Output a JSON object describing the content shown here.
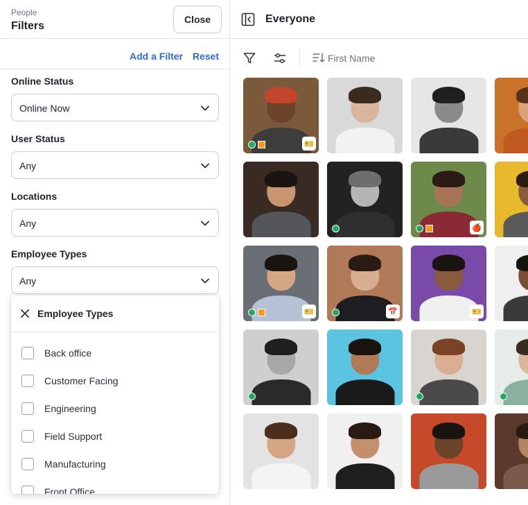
{
  "filters_panel": {
    "breadcrumb": "People",
    "title": "Filters",
    "close_label": "Close",
    "add_filter_label": "Add a Filter",
    "reset_label": "Reset",
    "accent_color": "#2e6bd1",
    "fields": [
      {
        "label": "Online Status",
        "value": "Online Now"
      },
      {
        "label": "User Status",
        "value": "Any"
      },
      {
        "label": "Locations",
        "value": "Any"
      },
      {
        "label": "Employee Types",
        "value": "Any"
      }
    ],
    "dropdown": {
      "title": "Employee Types",
      "options": [
        {
          "label": "Back office",
          "checked": false
        },
        {
          "label": "Customer Facing",
          "checked": false
        },
        {
          "label": "Engineering",
          "checked": false
        },
        {
          "label": "Field Support",
          "checked": false
        },
        {
          "label": "Manufacturing",
          "checked": false
        },
        {
          "label": "Front Office",
          "checked": false
        }
      ]
    }
  },
  "people_panel": {
    "title": "Everyone",
    "sort_label": "First Name",
    "online_color": "#22a861",
    "badge_color": "#f59a23",
    "rows": [
      [
        {
          "bg": "#7a5a3a",
          "skin": "#6b4328",
          "cloth": "#3d3d3d",
          "hair": "#c2452d",
          "online": true,
          "badge": true,
          "corner": "ticket-icon"
        },
        {
          "bg": "#d9d9d9",
          "skin": "#d9b59c",
          "cloth": "#f2f2f2",
          "hair": "#3a2a20",
          "online": false,
          "badge": false,
          "corner": ""
        },
        {
          "bg": "#e6e6e6",
          "skin": "#8a8a8a",
          "cloth": "#3a3a3a",
          "hair": "#1f1f1f",
          "online": false,
          "badge": false,
          "corner": ""
        },
        {
          "bg": "#c9722a",
          "skin": "#d9a27a",
          "cloth": "#c05a20",
          "hair": "#5a3018",
          "online": false,
          "badge": false,
          "corner": ""
        }
      ],
      [
        {
          "bg": "#3a2a24",
          "skin": "#c99470",
          "cloth": "#55565a",
          "hair": "#1a1410",
          "online": false,
          "badge": false,
          "corner": ""
        },
        {
          "bg": "#222222",
          "skin": "#b5b5b5",
          "cloth": "#303030",
          "hair": "#6e6e6e",
          "online": true,
          "badge": false,
          "corner": ""
        },
        {
          "bg": "#6d8a4a",
          "skin": "#a87456",
          "cloth": "#8a2a35",
          "hair": "#2a1c14",
          "online": true,
          "badge": true,
          "corner": "apple-icon"
        },
        {
          "bg": "#e8b92a",
          "skin": "#8a5a3c",
          "cloth": "#5a5a5a",
          "hair": "#2a1a10",
          "online": false,
          "badge": false,
          "corner": ""
        }
      ],
      [
        {
          "bg": "#6a6f76",
          "skin": "#d4a684",
          "cloth": "#b5c2d6",
          "hair": "#1a1410",
          "online": true,
          "badge": true,
          "corner": "ticket-icon"
        },
        {
          "bg": "#b07a58",
          "skin": "#d7ae90",
          "cloth": "#1e1e22",
          "hair": "#2a1a14",
          "online": true,
          "badge": false,
          "corner": "calendar-icon"
        },
        {
          "bg": "#7a4aa8",
          "skin": "#8a5a3c",
          "cloth": "#f0f0f0",
          "hair": "#1a1410",
          "online": false,
          "badge": false,
          "corner": "ticket-icon"
        },
        {
          "bg": "#efefef",
          "skin": "#7a4e34",
          "cloth": "#3a3a3a",
          "hair": "#1a1410",
          "online": false,
          "badge": false,
          "corner": ""
        }
      ],
      [
        {
          "bg": "#cfcfcf",
          "skin": "#a8a8a8",
          "cloth": "#2a2a2a",
          "hair": "#1f1f1f",
          "online": true,
          "badge": false,
          "corner": ""
        },
        {
          "bg": "#5bc4e0",
          "skin": "#b07a58",
          "cloth": "#1a1a1a",
          "hair": "#1a1410",
          "online": false,
          "badge": false,
          "corner": ""
        },
        {
          "bg": "#d8d4d0",
          "skin": "#d9ae92",
          "cloth": "#4a4a4a",
          "hair": "#7a4326",
          "online": true,
          "badge": false,
          "corner": ""
        },
        {
          "bg": "#e6ece8",
          "skin": "#d9b59c",
          "cloth": "#8ab0a0",
          "hair": "#3a2a20",
          "online": true,
          "badge": false,
          "corner": ""
        }
      ],
      [
        {
          "bg": "#e3e3e3",
          "skin": "#d4a684",
          "cloth": "#f4f4f4",
          "hair": "#4a2e1c",
          "online": false,
          "badge": false,
          "corner": ""
        },
        {
          "bg": "#f0f0f0",
          "skin": "#c4906c",
          "cloth": "#1e1e1e",
          "hair": "#2a1a14",
          "online": false,
          "badge": false,
          "corner": ""
        },
        {
          "bg": "#c44a2a",
          "skin": "#6b4328",
          "cloth": "#9a9a9a",
          "hair": "#1a1410",
          "online": false,
          "badge": false,
          "corner": ""
        },
        {
          "bg": "#5a3a2a",
          "skin": "#b58464",
          "cloth": "#7a5a4a",
          "hair": "#2a1a10",
          "online": false,
          "badge": false,
          "corner": ""
        }
      ]
    ]
  }
}
